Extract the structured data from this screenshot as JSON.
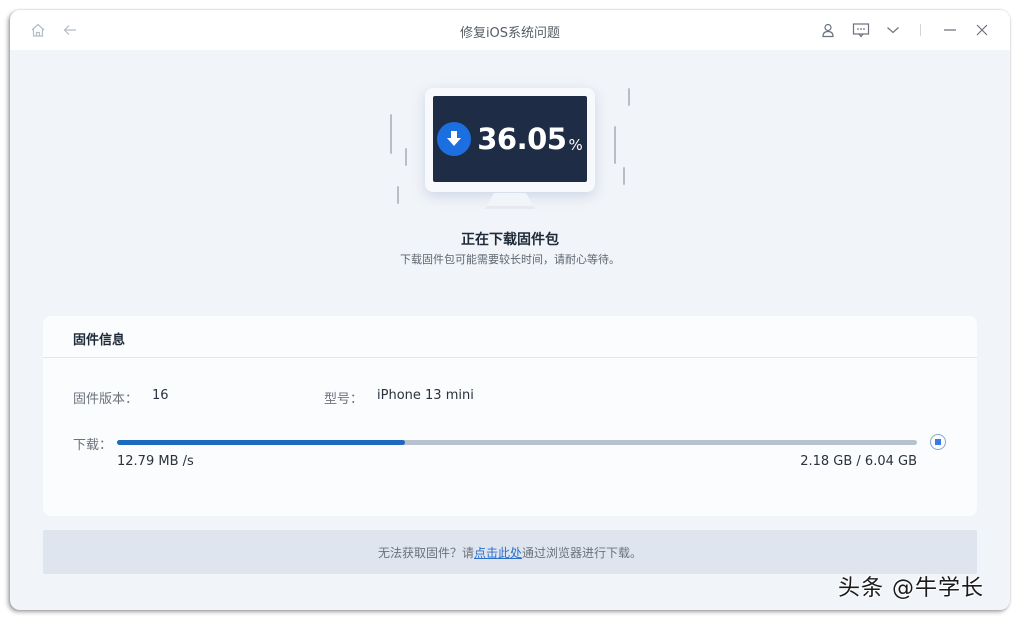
{
  "window": {
    "title": "修复iOS系统问题",
    "icons": {
      "home": "home-icon",
      "back": "back-arrow-icon",
      "user": "user-icon",
      "feedback": "message-icon",
      "menu": "chevron-down-icon",
      "minimize": "minimize-icon",
      "close": "close-icon"
    }
  },
  "download_status": {
    "percent": "36.05",
    "percent_sign": "%",
    "progress_fraction": 0.3605,
    "title": "正在下载固件包",
    "subtitle": "下载固件包可能需要较长时间，请耐心等待。"
  },
  "firmware_info": {
    "section_title": "固件信息",
    "version_label": "固件版本：",
    "version_value": "16",
    "model_label": "型号：",
    "model_value": "iPhone 13 mini",
    "download_label": "下载：",
    "speed": "12.79 MB /s",
    "size_progress": "2.18 GB / 6.04 GB"
  },
  "footer": {
    "text_before": "无法获取固件？请",
    "link_text": "点击此处",
    "text_after": "通过浏览器进行下载。"
  },
  "watermark": "头条 @牛学长",
  "colors": {
    "accent": "#1b6ac0",
    "screen_bg": "#1e2d45",
    "download_icon": "#1b6fe0"
  }
}
